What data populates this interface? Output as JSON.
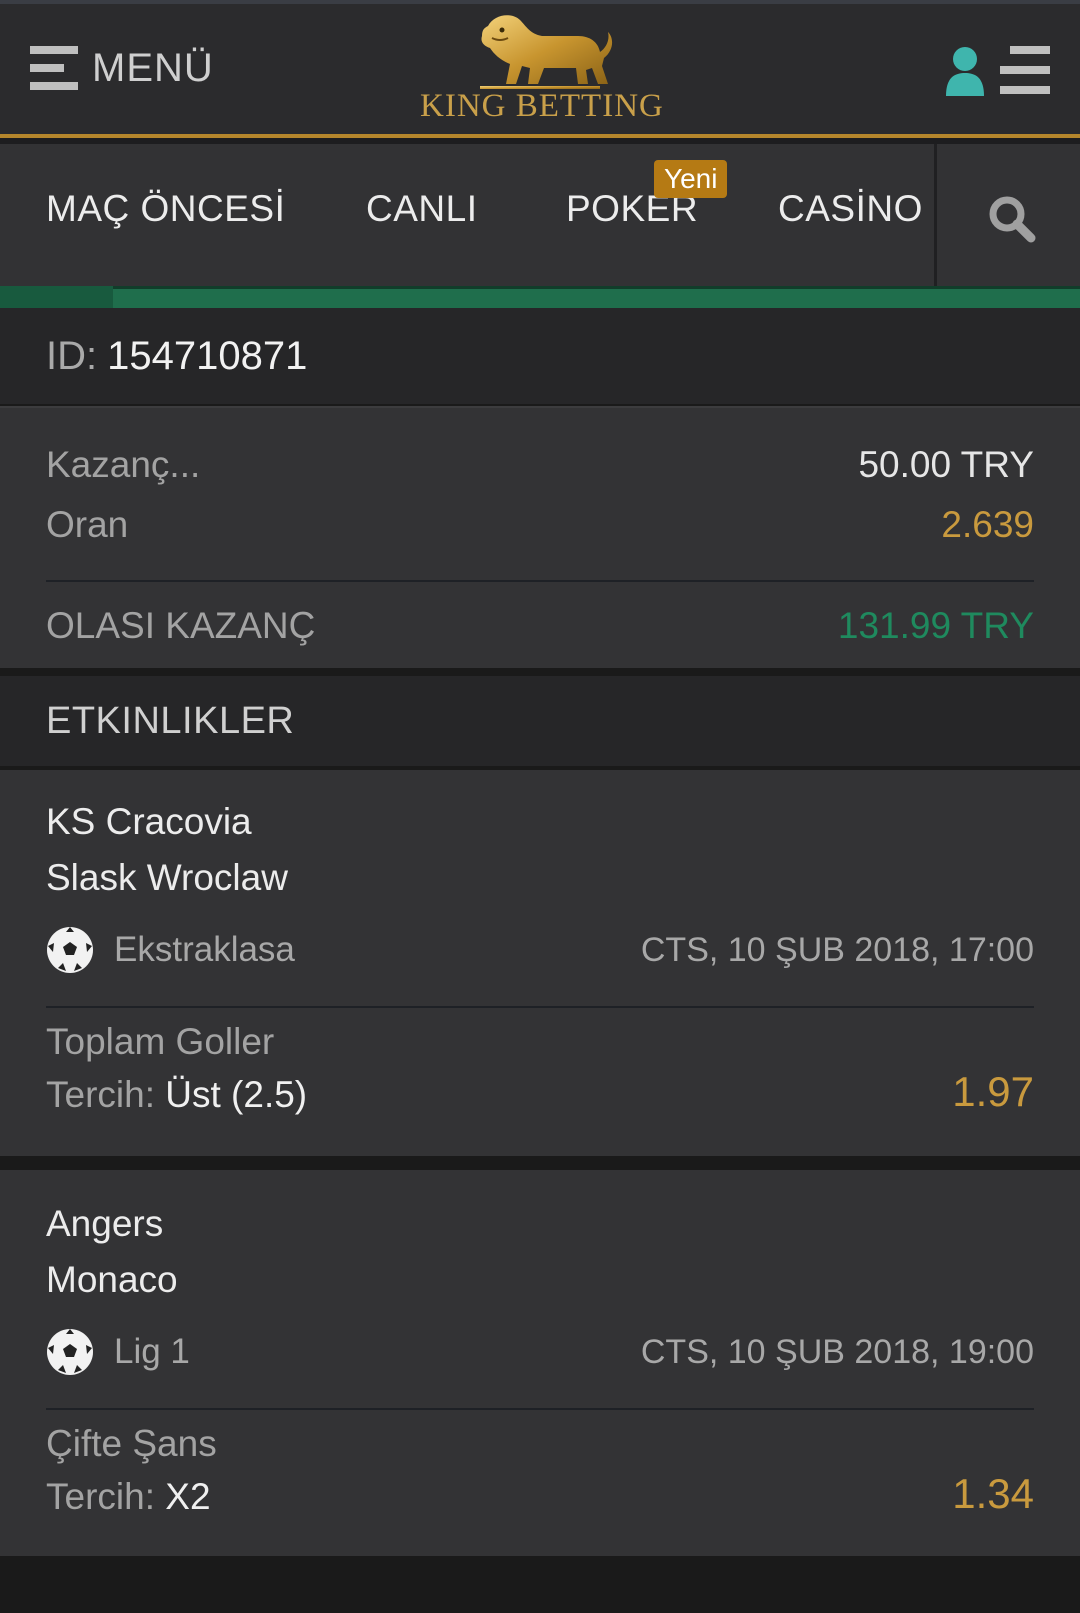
{
  "header": {
    "menu_label": "MENÜ",
    "logo_text": "KING BETTING",
    "brand_color": "#c9a04a"
  },
  "nav": {
    "items": [
      "MAÇ ÖNCESİ",
      "CANLI",
      "POKER",
      "CASİNO"
    ],
    "badge": "Yeni"
  },
  "bet": {
    "id_label": "ID:",
    "id_value": "154710871",
    "stake_label": "Kazanç...",
    "stake_value": "50.00 TRY",
    "odds_label": "Oran",
    "odds_value": "2.639",
    "potential_label": "OLASI KAZANÇ",
    "potential_value": "131.99 TRY"
  },
  "events_title": "ETKINLIKLER",
  "events": [
    {
      "home": "KS Cracovia",
      "away": "Slask Wroclaw",
      "league": "Ekstraklasa",
      "date": "CTS, 10 ŞUB 2018, 17:00",
      "market": "Toplam Goller",
      "pick_label": "Tercih:",
      "pick": "Üst (2.5)",
      "odd": "1.97"
    },
    {
      "home": "Angers",
      "away": "Monaco",
      "league": "Lig 1",
      "date": "CTS, 10 ŞUB 2018, 19:00",
      "market": "Çifte Şans",
      "pick_label": "Tercih:",
      "pick": "X2",
      "odd": "1.34"
    }
  ]
}
